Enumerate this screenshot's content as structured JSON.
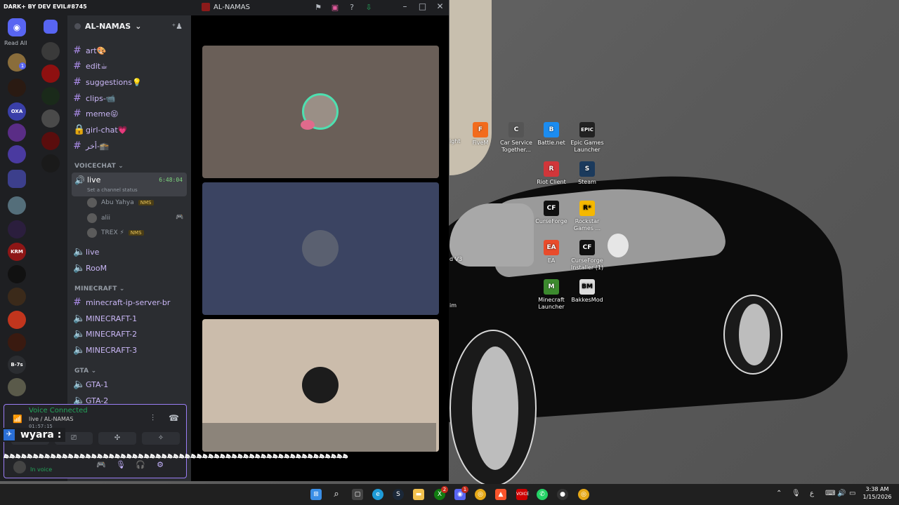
{
  "window": {
    "brand": "DARK+ BY DEV EVIL#8745",
    "title": "AL-NAMAS"
  },
  "rail": {
    "read_all": "Read All",
    "unread_badge": "1",
    "servers": [
      "OXA",
      "KRM",
      "B-7s"
    ]
  },
  "server": {
    "name": "AL-NAMAS"
  },
  "channels": {
    "text": [
      "art🎨",
      "edit☕",
      "suggestions💡",
      "clips-📹",
      "meme😝",
      "girl-chat💗",
      "أخر-🕋"
    ],
    "voicechat_label": "VOICECHAT",
    "live": {
      "name": "live",
      "timer": "6:48:04",
      "status": "Set a channel status"
    },
    "voice_users": [
      {
        "name": "Abu Yahya",
        "badge": "NMS"
      },
      {
        "name": "alii",
        "badge": ""
      },
      {
        "name": "TREX ⚡",
        "badge": "NMS"
      }
    ],
    "voice_more": [
      "live",
      "RooM"
    ],
    "minecraft_label": "MINECRAFT",
    "minecraft": [
      "minecraft-ip-server-br",
      "MINECRAFT-1",
      "MINECRAFT-2",
      "MINECRAFT-3"
    ],
    "gta_label": "GTA",
    "gta": [
      "GTA-1",
      "GTA-2"
    ]
  },
  "voice": {
    "status": "Voice Connected",
    "channel": "live / AL-NAMAS",
    "elapsed": "01:57:15",
    "overlay_name": "wyara :",
    "wave": "ﻫﻫﻫﻫﻫﻫﻫﻫﻫﻫﻫﻫﻫﻫﻫﻫﻫﻫﻫﻫﻫﻫﻫﻫﻫﻫﻫﻫﻫﻫﻫﻫﻫﻫﻫﻫﻫﻫﻫﻫﻫﻫﻫﻫﻫﻫﻫﻫﻫﻫﻫﻫﻫﻫﻫﻫﻫﻫﻫ",
    "user_status": "In voice"
  },
  "desktop": {
    "icons": [
      {
        "label": "FiveM",
        "color": "#f26b1d",
        "glyph": "F"
      },
      {
        "label": "Car Service Together...",
        "color": "#555555",
        "glyph": "C"
      },
      {
        "label": "Battle.net",
        "color": "#1b8cf0",
        "glyph": "B"
      },
      {
        "label": "Epic Games Launcher",
        "color": "#222222",
        "glyph": "EPIC"
      },
      {
        "label": "Riot Client",
        "color": "#d1363a",
        "glyph": "R"
      },
      {
        "label": "Steam",
        "color": "#1b3a5c",
        "glyph": "S"
      },
      {
        "label": "CurseForge",
        "color": "#111111",
        "glyph": "CF"
      },
      {
        "label": "Rockstar Games ...",
        "color": "#f5b800",
        "glyph": "R*"
      },
      {
        "label": "EA",
        "color": "#e94b2b",
        "glyph": "EA"
      },
      {
        "label": "CurseForge Installer (1)",
        "color": "#111111",
        "glyph": "CF"
      },
      {
        "label": "Minecraft Launcher",
        "color": "#3c8a2e",
        "glyph": "M"
      },
      {
        "label": "BakkesMod",
        "color": "#dddddd",
        "glyph": "BM"
      }
    ],
    "partial_labels": [
      "ight",
      "d V3",
      "im"
    ]
  },
  "taskbar": {
    "time": "3:38 AM",
    "date": "1/15/2026",
    "xbox_badge": "2",
    "discord_badge": "1",
    "lang": "ع"
  }
}
